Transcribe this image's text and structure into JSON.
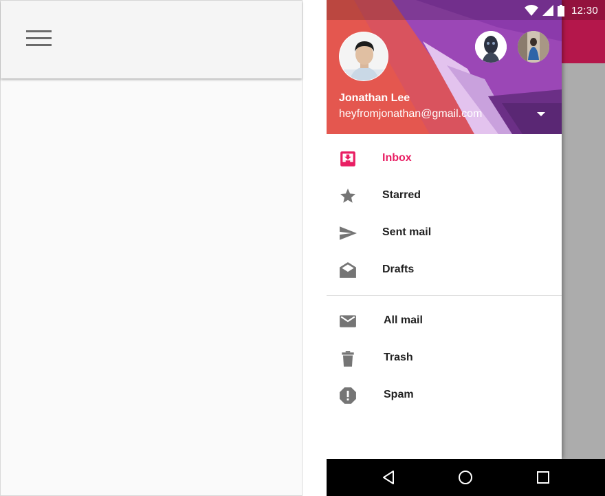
{
  "status_bar": {
    "time": "12:30",
    "icons": [
      "wifi-icon",
      "cell-signal-icon",
      "battery-icon"
    ]
  },
  "left_screen": {
    "menu_icon": "hamburger-menu-icon"
  },
  "drawer": {
    "header": {
      "user_name": "Jonathan Lee",
      "user_email": "heyfromjonathan@gmail.com",
      "dropdown_icon": "arrow-drop-down-icon"
    },
    "group_1": [
      {
        "label": "Inbox",
        "icon": "inbox-icon",
        "active": true
      },
      {
        "label": "Starred",
        "icon": "star-icon",
        "active": false
      },
      {
        "label": "Sent mail",
        "icon": "send-icon",
        "active": false
      },
      {
        "label": "Drafts",
        "icon": "drafts-icon",
        "active": false
      }
    ],
    "group_2": [
      {
        "label": "All mail",
        "icon": "mail-icon"
      },
      {
        "label": "Trash",
        "icon": "trash-icon"
      },
      {
        "label": "Spam",
        "icon": "spam-icon"
      }
    ]
  },
  "system_nav": {
    "buttons": [
      "back-icon",
      "home-icon",
      "recents-icon"
    ]
  },
  "colors": {
    "accent": "#e91e63",
    "app_bar": "#b4174b",
    "header_red": "#e8534a",
    "header_purple": "#8e3fb0",
    "icon_gray": "#757575",
    "scrim": "#acacac"
  }
}
